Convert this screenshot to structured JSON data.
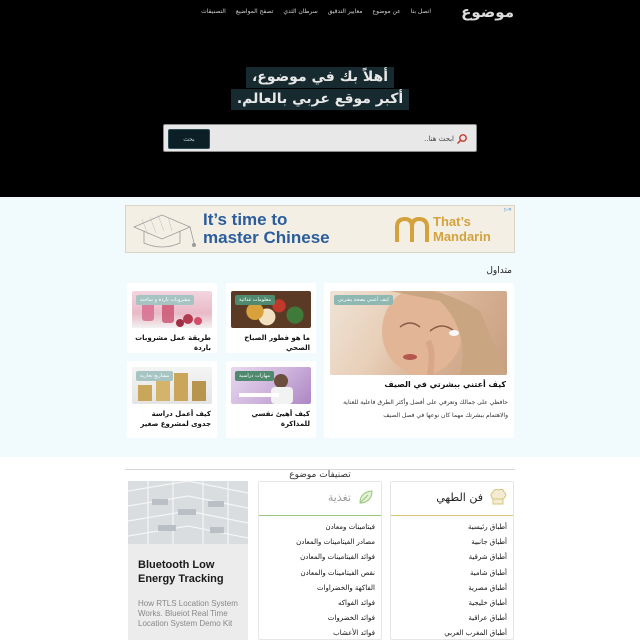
{
  "site": {
    "logo": "موضوع"
  },
  "nav": {
    "items": [
      "التصنيفات",
      "تصفح المواضيع",
      "سرطان الثدي",
      "معايير التدقيق",
      "عن موضوع",
      "اتصل بنا"
    ]
  },
  "hero": {
    "title_line1": "أهلاً بك في موضوع،",
    "title_line2": "أكبر موقع عربي بالعالم."
  },
  "search": {
    "placeholder": "ابحث هنا..",
    "button_label": "بحث"
  },
  "ad_banner": {
    "line1": "It’s time to",
    "line2": "master Chinese",
    "brand_line1": "That’s",
    "brand_line2": "Mandarin"
  },
  "trending": {
    "title": "متداول",
    "featured": {
      "badge": "كيف أعتني بصحة بشرتي",
      "title": "كيف أعتني ببشرتي في الصيف",
      "description": "حافظي على جمالك وتعرفي على أفضل وأكثر الطرق فاعلية للعناية والاهتمام ببشرتك مهما كان نوعها في فصل الصيف"
    },
    "cards": [
      {
        "badge": "معلومات غذائية",
        "title": "ما هو فطور الصباح الصحي"
      },
      {
        "badge": "مشروبات باردة و ساخنة",
        "title": "طريقة عمل مشروبات باردة"
      },
      {
        "badge": "مهارات دراسية",
        "title": "كيف أهيئ نفسي للمذاكرة"
      },
      {
        "badge": "مشاريع تجارية",
        "title": "كيف أعمل دراسة جدوى لمشروع صغير"
      }
    ]
  },
  "categories": {
    "title": "تصنيفات موضوع",
    "cooking": {
      "title": "فن الطهي",
      "items": [
        "أطباق رئيسية",
        "أطباق جانبية",
        "أطباق شرقية",
        "أطباق شامية",
        "أطباق مصرية",
        "أطباق خليجية",
        "أطباق عراقية",
        "أطباق المغرب العربي"
      ]
    },
    "nutrition": {
      "title": "تغذية",
      "items": [
        "فيتامينات ومعادن",
        "مصادر الفيتامينات والمعادن",
        "فوائد الفيتامينات والمعادن",
        "نقص الفيتامينات والمعادن",
        "الفاكهة والخضراوات",
        "فوائد الفواكه",
        "فوائد الخضروات",
        "فوائد الأعشاب"
      ]
    }
  },
  "side_ad": {
    "title": "Bluetooth Low Energy Tracking",
    "text": "How RTLS Location System Works. Blueiot Real Time Location System Demo Kit"
  },
  "colors": {
    "hero_bg": "#000000",
    "mid_bg": "#f1fafc",
    "cooking_accent": "#d9c57a",
    "nutrition_accent": "#9bc77a"
  }
}
